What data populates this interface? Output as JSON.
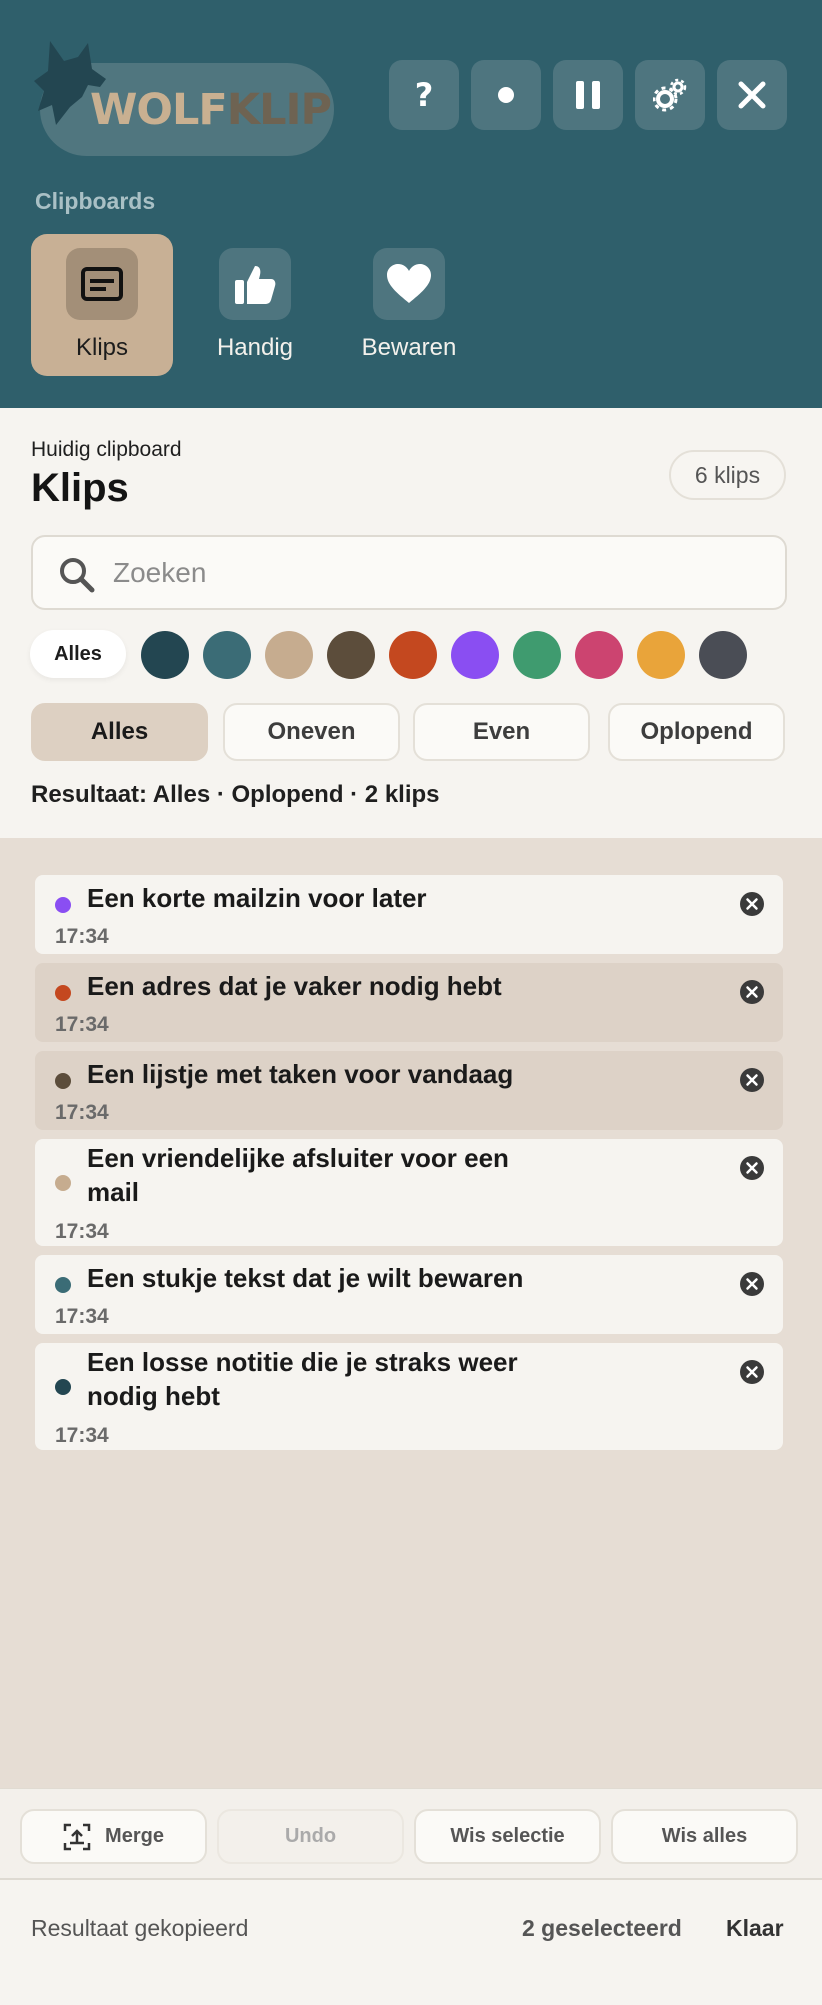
{
  "header": {
    "logo": {
      "part1": "WOLF",
      "part2": "KLIP"
    },
    "buttons": [
      {
        "name": "help-button",
        "icon": "question-icon"
      },
      {
        "name": "record-button",
        "icon": "dot-icon"
      },
      {
        "name": "pause-button",
        "icon": "pause-icon"
      },
      {
        "name": "settings-button",
        "icon": "gears-icon"
      },
      {
        "name": "close-button",
        "icon": "close-icon"
      }
    ],
    "clipboards_label": "Clipboards",
    "clipboards": [
      {
        "label": "Klips",
        "icon": "clipboard-icon",
        "active": true
      },
      {
        "label": "Handig",
        "icon": "thumbs-up-icon",
        "active": false
      },
      {
        "label": "Bewaren",
        "icon": "heart-icon",
        "active": false
      }
    ]
  },
  "current": {
    "subtitle": "Huidig clipboard",
    "title": "Klips",
    "count": "6 klips"
  },
  "search": {
    "placeholder": "Zoeken",
    "value": ""
  },
  "colors": {
    "all_label": "Alles",
    "swatches": [
      "#234651",
      "#3b6c76",
      "#c6ac8f",
      "#5c4d3b",
      "#c4481f",
      "#8a4ef2",
      "#3f9b6f",
      "#cc4470",
      "#e9a43a",
      "#4a4d55"
    ]
  },
  "filters": [
    {
      "label": "Alles",
      "active": true
    },
    {
      "label": "Oneven",
      "active": false
    },
    {
      "label": "Even",
      "active": false
    },
    {
      "label": "Oplopend",
      "active": false
    }
  ],
  "result": "Resultaat: Alles · Oplopend · 2 klips",
  "clips": [
    {
      "text": "Een korte mailzin voor later",
      "time": "17:34",
      "color": "#8a4ef2",
      "selected": false
    },
    {
      "text": "Een adres dat je vaker nodig hebt",
      "time": "17:34",
      "color": "#c4481f",
      "selected": true
    },
    {
      "text": "Een lijstje met taken voor vandaag",
      "time": "17:34",
      "color": "#5c4d3b",
      "selected": true
    },
    {
      "text": "Een vriendelijke afsluiter voor een mail",
      "time": "17:34",
      "color": "#c6ac8f",
      "selected": false
    },
    {
      "text": "Een stukje tekst dat je wilt bewaren",
      "time": "17:34",
      "color": "#3b6c76",
      "selected": false
    },
    {
      "text": "Een losse notitie die je straks weer nodig hebt",
      "time": "17:34",
      "color": "#234651",
      "selected": false
    }
  ],
  "actions": {
    "merge": "Merge",
    "undo": "Undo",
    "clear_selection": "Wis selectie",
    "clear_all": "Wis alles"
  },
  "status": {
    "message": "Resultaat gekopieerd",
    "selected": "2 geselecteerd",
    "done": "Klaar"
  }
}
